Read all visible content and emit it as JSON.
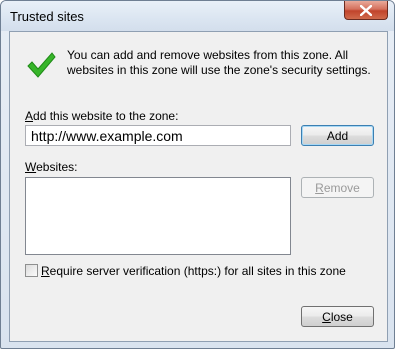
{
  "window": {
    "title": "Trusted sites"
  },
  "info": {
    "icon": "checkmark-icon",
    "accent_color": "#2ea71f",
    "message": "You can add and remove websites from this zone. All websites in this zone will use the zone's security settings."
  },
  "add_section": {
    "label_mnemonic": "A",
    "label_rest": "dd this website to the zone:",
    "url_value": "http://www.example.com",
    "add_button": "Add"
  },
  "websites": {
    "label_mnemonic": "W",
    "label_rest": "ebsites:",
    "items": [],
    "remove_mnemonic": "R",
    "remove_rest": "emove"
  },
  "verification": {
    "checked": false,
    "label_mnemonic": "R",
    "label_rest": "equire server verification (https:) for all sites in this zone"
  },
  "footer": {
    "close_mnemonic": "C",
    "close_rest": "lose"
  }
}
